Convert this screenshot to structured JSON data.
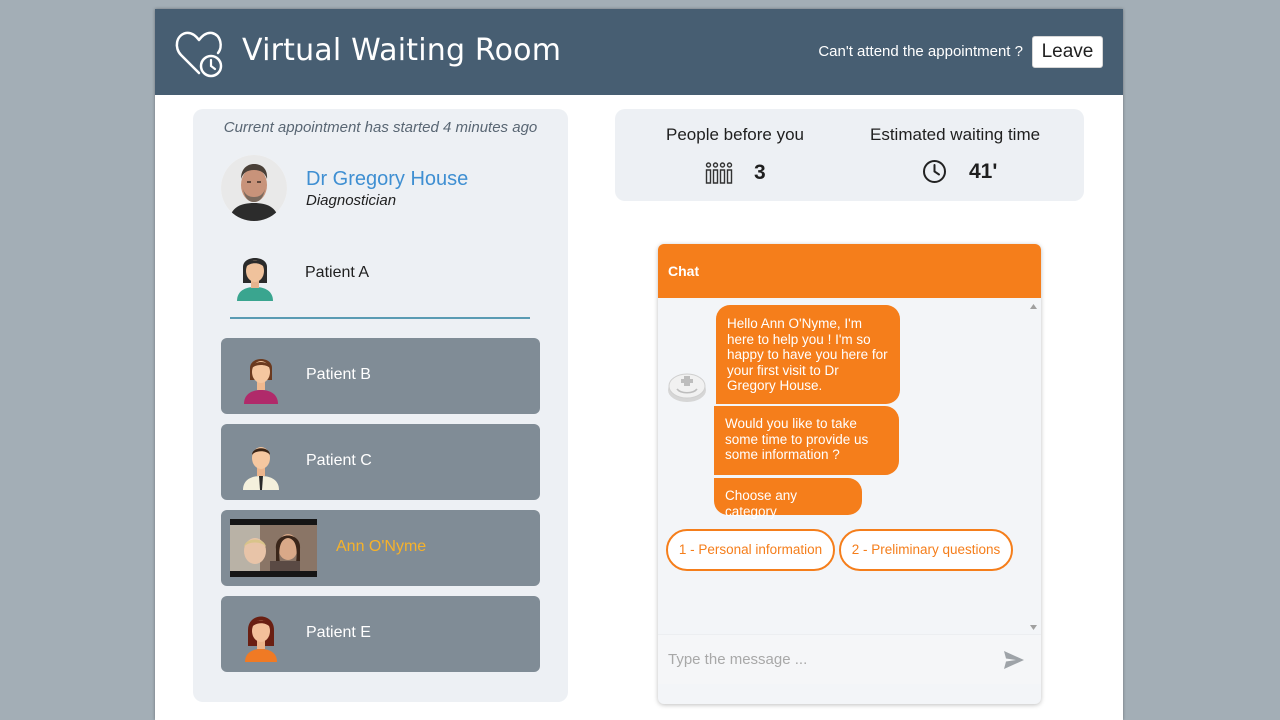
{
  "header": {
    "title": "Virtual Waiting Room",
    "cant_attend": "Can't attend the appointment ?",
    "leave_label": "Leave"
  },
  "appointment": {
    "status_text": "Current appointment has started 4 minutes ago",
    "doctor_name": "Dr Gregory House",
    "doctor_role": "Diagnostician",
    "current_patient": "Patient A"
  },
  "queue": [
    {
      "label": "Patient B",
      "icon": "woman-avatar-icon"
    },
    {
      "label": "Patient C",
      "icon": "man-avatar-icon"
    },
    {
      "label": "Ann O'Nyme",
      "icon": "video-thumbnail",
      "is_self": true
    },
    {
      "label": "Patient E",
      "icon": "girl-avatar-icon"
    }
  ],
  "stats": {
    "people_label": "People before you",
    "people_value": "3",
    "wait_label": "Estimated waiting time",
    "wait_value": "41'"
  },
  "chat": {
    "title": "Chat",
    "messages": [
      "Hello Ann O'Nyme, I'm here to help you ! I'm so happy to have you here for your first visit to Dr Gregory House.",
      "Would you like to take some time to provide us some information ?",
      "Choose any category"
    ],
    "options": [
      "1 - Personal information",
      "2 - Preliminary questions"
    ],
    "input_placeholder": "Type the message ..."
  },
  "colors": {
    "topbar": "#475e72",
    "accent_orange": "#f57e1b",
    "doctor_blue": "#3f8fd2",
    "self_highlight": "#f6b22a",
    "queue_item": "#808c96"
  }
}
